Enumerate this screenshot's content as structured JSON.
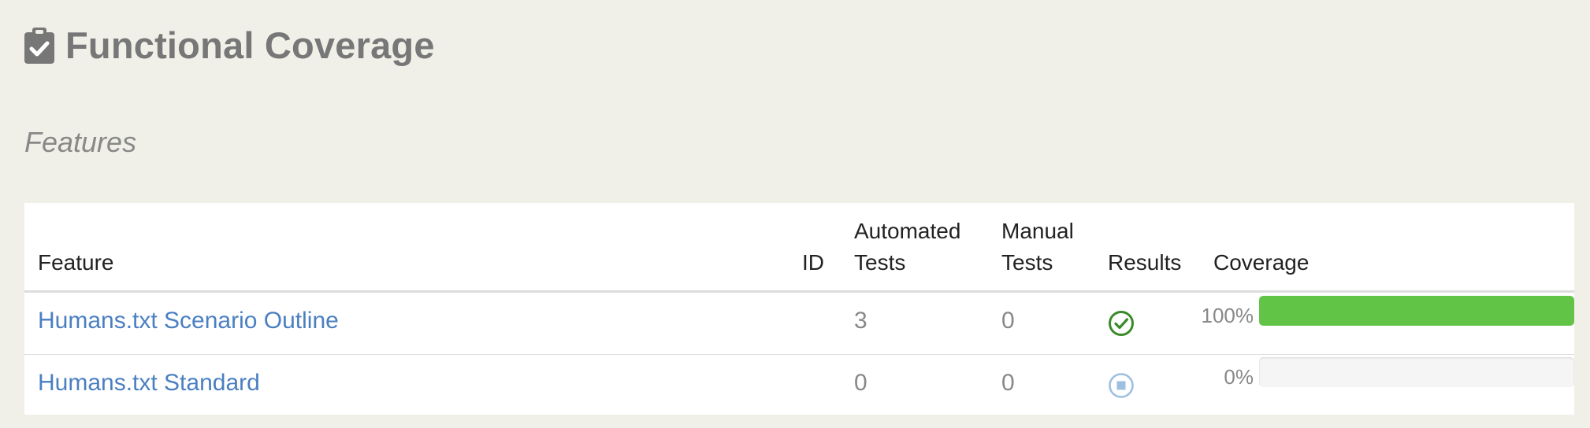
{
  "header": {
    "icon": "clipboard-check-icon",
    "title": "Functional Coverage"
  },
  "section": {
    "title": "Features"
  },
  "table": {
    "columns": {
      "feature": "Feature",
      "id": "ID",
      "automated_line1": "Automated",
      "automated_line2": "Tests",
      "manual_line1": "Manual",
      "manual_line2": "Tests",
      "results": "Results",
      "coverage": "Coverage"
    },
    "rows": [
      {
        "feature": "Humans.txt Scenario Outline",
        "id": "",
        "automated": "3",
        "manual": "0",
        "result_icon": "check-circle-icon",
        "result_color": "#3a8a2a",
        "coverage_label": "100%",
        "coverage_fraction": 1.0
      },
      {
        "feature": "Humans.txt Standard",
        "id": "",
        "automated": "0",
        "manual": "0",
        "result_icon": "stop-circle-icon",
        "result_color": "#9dbfe0",
        "coverage_label": "0%",
        "coverage_fraction": 0.0
      }
    ]
  },
  "colors": {
    "background": "#f0f0e8",
    "link": "#4a7fc1",
    "progress_fill": "#62c446",
    "progress_track": "#f5f5f5"
  }
}
